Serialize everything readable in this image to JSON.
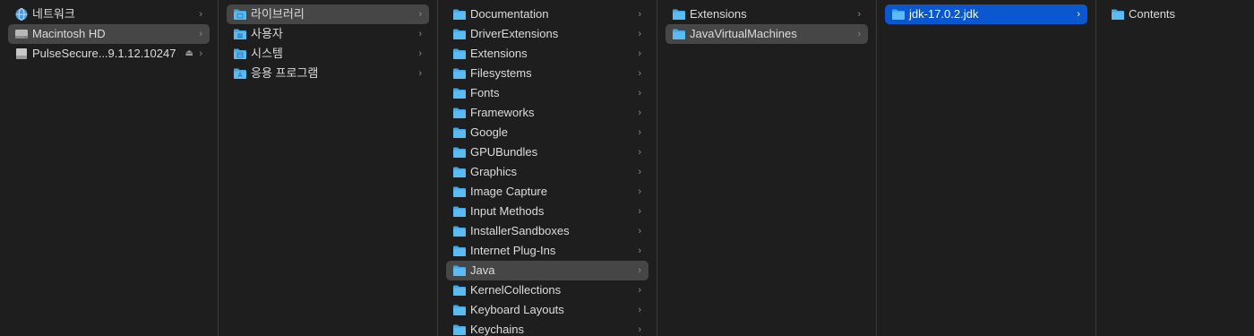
{
  "columns": [
    {
      "items": [
        {
          "label": "네트워크",
          "icon": "network-globe-icon"
        },
        {
          "label": "Macintosh HD",
          "icon": "hard-drive-icon"
        },
        {
          "label": "PulseSecure...9.1.12.10247",
          "icon": "disk-image-icon",
          "eject": "⏏"
        }
      ]
    },
    {
      "items": [
        {
          "label": "라이브러리",
          "icon": "folder-icon"
        },
        {
          "label": "사용자",
          "icon": "users-folder-icon"
        },
        {
          "label": "시스템",
          "icon": "system-folder-icon"
        },
        {
          "label": "응용 프로그램",
          "icon": "applications-folder-icon"
        }
      ]
    },
    {
      "items": [
        {
          "label": "Documentation"
        },
        {
          "label": "DriverExtensions"
        },
        {
          "label": "Extensions"
        },
        {
          "label": "Filesystems"
        },
        {
          "label": "Fonts"
        },
        {
          "label": "Frameworks"
        },
        {
          "label": "Google"
        },
        {
          "label": "GPUBundles"
        },
        {
          "label": "Graphics"
        },
        {
          "label": "Image Capture"
        },
        {
          "label": "Input Methods"
        },
        {
          "label": "InstallerSandboxes"
        },
        {
          "label": "Internet Plug-Ins"
        },
        {
          "label": "Java"
        },
        {
          "label": "KernelCollections"
        },
        {
          "label": "Keyboard Layouts"
        },
        {
          "label": "Keychains"
        }
      ]
    },
    {
      "items": [
        {
          "label": "Extensions"
        },
        {
          "label": "JavaVirtualMachines"
        }
      ]
    },
    {
      "items": [
        {
          "label": "jdk-17.0.2.jdk"
        }
      ]
    },
    {
      "items": [
        {
          "label": "Contents"
        }
      ]
    }
  ],
  "chevron": "›",
  "colors": {
    "background": "#1e1e1e",
    "selected_active": "#0a57d0",
    "selected_inactive": "#464646",
    "folder_blue": "#3ea8e8"
  }
}
